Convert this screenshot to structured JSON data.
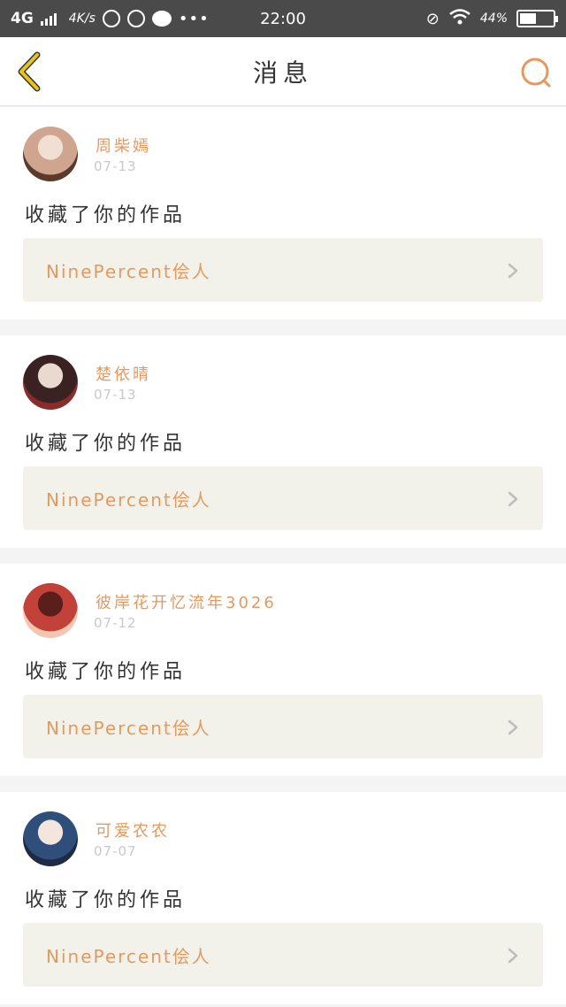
{
  "status_bar": {
    "network": "4G",
    "speed": "4K/s",
    "time": "22:00",
    "battery": "44%",
    "battery_level": 0.44,
    "icons": [
      "signal-icon",
      "weibo-icon",
      "qq-icon",
      "chat-icon",
      "more-icon",
      "mute-icon",
      "wifi-icon",
      "battery-icon"
    ]
  },
  "header": {
    "title": "消息",
    "back_icon": "chevron-left-icon",
    "search_icon": "search-icon"
  },
  "colors": {
    "accent": "#e39a5f",
    "back": "#e6c419",
    "card_bg": "#ffffff",
    "work_bg": "#f2f2ea"
  },
  "messages": [
    {
      "username": "周柴嫣",
      "date": "07-13",
      "action": "收藏了你的作品",
      "work_title": "NinePercent侩人",
      "avatar_palette": [
        "#cfa58f",
        "#f1dfd3",
        "#5b3a2c"
      ]
    },
    {
      "username": "楚依晴",
      "date": "07-13",
      "action": "收藏了你的作品",
      "work_title": "NinePercent侩人",
      "avatar_palette": [
        "#3a2222",
        "#e9d9cf",
        "#8a2c2c"
      ]
    },
    {
      "username": "彼岸花开忆流年3026",
      "date": "07-12",
      "action": "收藏了你的作品",
      "work_title": "NinePercent侩人",
      "avatar_palette": [
        "#c2423a",
        "#5a1f1b",
        "#f1c7b1"
      ]
    },
    {
      "username": "可爱农农",
      "date": "07-07",
      "action": "收藏了你的作品",
      "work_title": "NinePercent侩人",
      "avatar_palette": [
        "#2f4f7a",
        "#f3e6dd",
        "#1f2a44"
      ]
    }
  ]
}
